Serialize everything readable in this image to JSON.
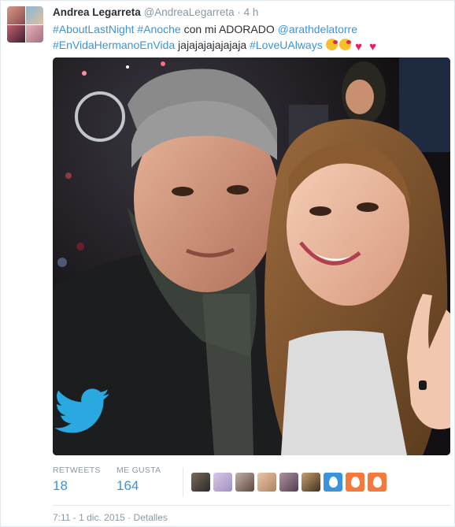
{
  "author": {
    "name": "Andrea Legarreta",
    "handle": "@AndreaLegarreta",
    "separator": "·",
    "time": "4 h"
  },
  "tweet": {
    "tag1": "#AboutLastNight",
    "tag2": "#Anoche",
    "text1": " con mi ADORADO ",
    "mention": "@arathdelatorre",
    "tag3": "#EnVidaHermanoEnVida",
    "text2": " jajajajajajajaja ",
    "tag4": "#LoveUAlways",
    "emojis": [
      "kissing-face",
      "kissing-face",
      "red-heart",
      "red-heart"
    ]
  },
  "photo": {
    "watermark_icon": "twitter-bird-icon"
  },
  "stats": {
    "retweets_label": "RETWEETS",
    "retweets_value": "18",
    "likes_label": "ME GUSTA",
    "likes_value": "164"
  },
  "footer": {
    "timestamp": "7:11 - 1 dic. 2015",
    "separator": "·",
    "details": "Detalles"
  },
  "colors": {
    "link": "#3b94d9",
    "muted": "#8899a6",
    "border": "#e1e8ed",
    "egg1": "#3b94d9",
    "egg2": "#f5793a"
  }
}
